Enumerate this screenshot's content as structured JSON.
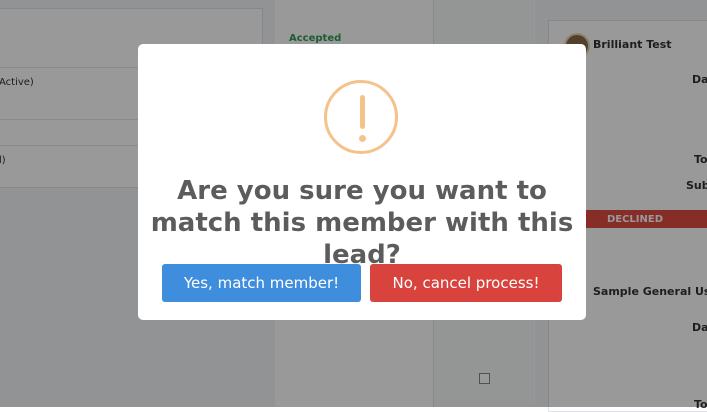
{
  "background": {
    "left_panel": {
      "row1": "Active)",
      "row2": "l)"
    },
    "middle_panel": {
      "status": "Accepted"
    },
    "right_panel": {
      "member_name": "Brilliant Test",
      "field1": "Da",
      "field2": "To",
      "field3": "Sub",
      "status": "DECLINED",
      "member_name_2": "Sample General User",
      "field4": "Da",
      "field5": "To"
    }
  },
  "dialog": {
    "icon": "warning-exclamation-icon",
    "title": "Are you sure you want to match this member with this lead?",
    "confirm_label": "Yes, match member!",
    "cancel_label": "No, cancel process!"
  },
  "colors": {
    "confirm": "#3f8ede",
    "cancel": "#d9433d",
    "warning": "#f5c28c",
    "accepted": "#2e9f52",
    "declined": "#e14b44"
  }
}
